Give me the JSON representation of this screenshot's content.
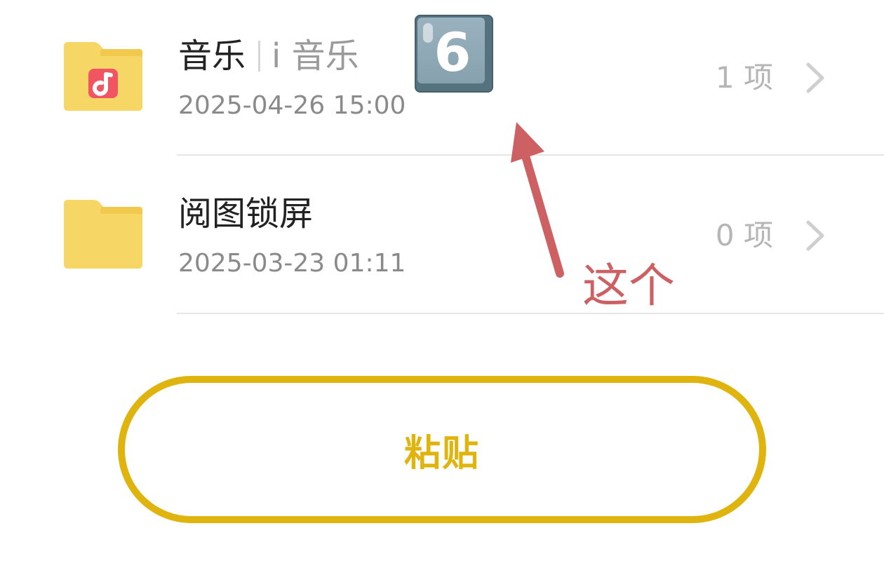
{
  "folders": [
    {
      "name": "音乐",
      "alias": "i 音乐",
      "date": "2025-04-26 15:00",
      "count": "1 项",
      "icon": "music-folder-icon"
    },
    {
      "name": "阅图锁屏",
      "date": "2025-03-23 01:11",
      "count": "0 项",
      "icon": "folder-icon"
    }
  ],
  "badge": {
    "digit": "6",
    "icon": "keycap-6-icon"
  },
  "annotation": {
    "text": "这个",
    "color": "#cd6062"
  },
  "paste_button": {
    "label": "粘贴",
    "color": "#e0b40e"
  },
  "colors": {
    "folder": "#f6d766",
    "folder_tab": "#f2c94c",
    "music_badge": "#f25562"
  }
}
